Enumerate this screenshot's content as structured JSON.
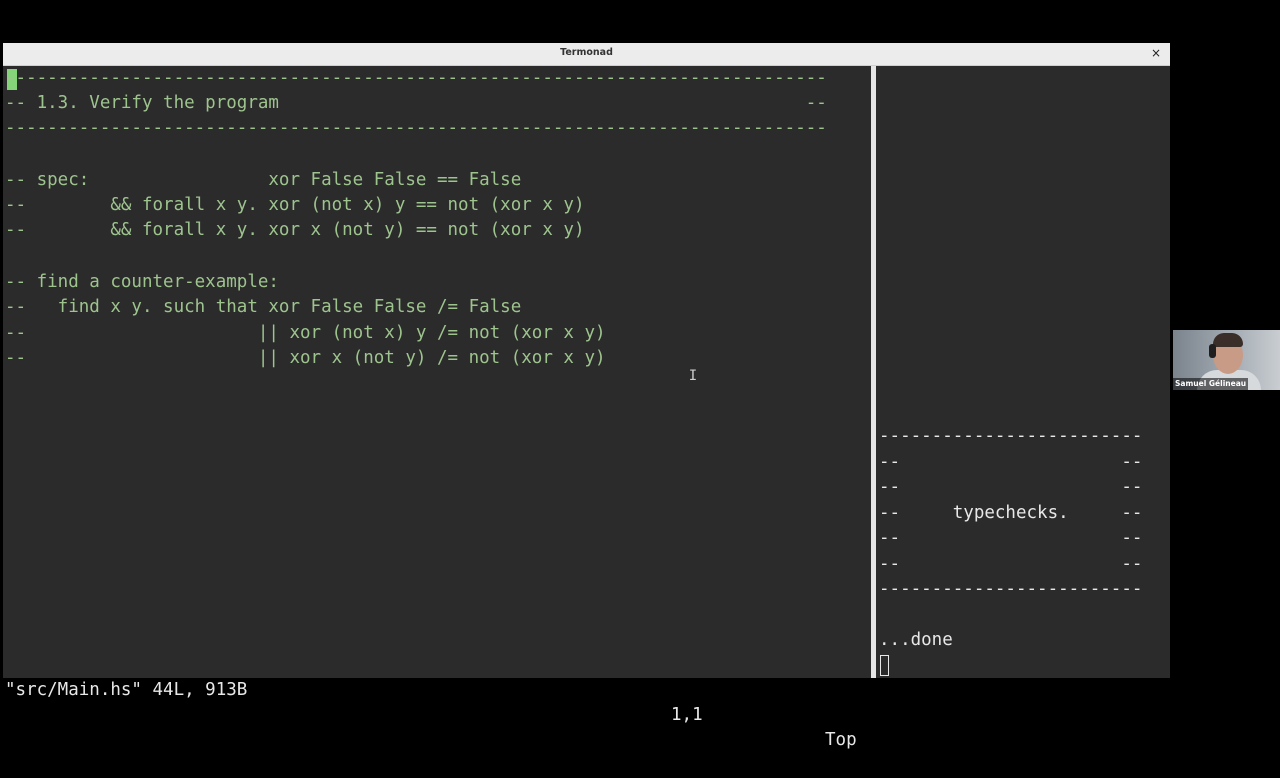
{
  "window": {
    "title": "Termonad",
    "close_glyph": "×"
  },
  "editor": {
    "lines": [
      "------------------------------------------------------------------------------",
      "-- 1.3. Verify the program                                                  --",
      "------------------------------------------------------------------------------",
      "",
      "-- spec:                 xor False False == False",
      "--        && forall x y. xor (not x) y == not (xor x y)",
      "--        && forall x y. xor x (not y) == not (xor x y)",
      "",
      "-- find a counter-example:",
      "--   find x y. such that xor False False /= False",
      "--                      || xor (not x) y /= not (xor x y)",
      "--                      || xor x (not y) /= not (xor x y)"
    ],
    "status": {
      "file": "\"src/Main.hs\" 44L, 913B",
      "position": "1,1",
      "scroll": "Top"
    }
  },
  "terminal": {
    "lines": [
      "-------------------------",
      "--                     --",
      "--                     --",
      "--     typechecks.     --",
      "--                     --",
      "--                     --",
      "-------------------------"
    ],
    "output": "...done"
  },
  "webcam": {
    "name": "Samuel Gélineau"
  },
  "colors": {
    "comment": "#9ec48e",
    "text": "#e8e8e8",
    "background": "#2b2b2b",
    "cursor": "#86d47a"
  }
}
